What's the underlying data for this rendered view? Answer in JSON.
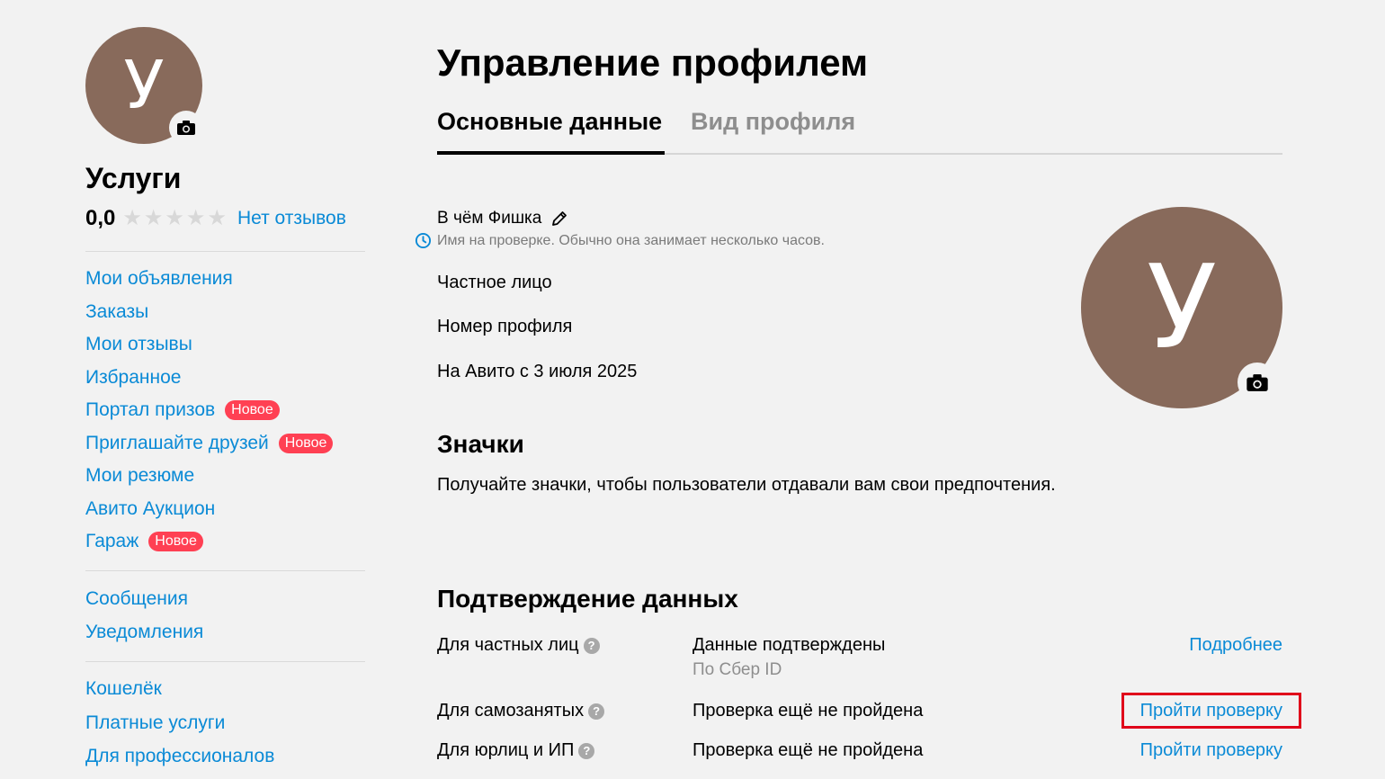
{
  "sidebar": {
    "avatar_letter": "У",
    "name": "Услуги",
    "rating": "0,0",
    "reviews_link": "Нет отзывов",
    "nav_group1": [
      {
        "label": "Мои объявления"
      },
      {
        "label": "Заказы"
      },
      {
        "label": "Мои отзывы"
      },
      {
        "label": "Избранное"
      },
      {
        "label": "Портал призов",
        "badge": "Новое"
      },
      {
        "label": "Приглашайте друзей",
        "badge": "Новое"
      },
      {
        "label": "Мои резюме"
      },
      {
        "label": "Авито Аукцион"
      },
      {
        "label": "Гараж",
        "badge": "Новое"
      }
    ],
    "nav_group2": [
      {
        "label": "Сообщения"
      },
      {
        "label": "Уведомления"
      }
    ],
    "nav_group3": [
      {
        "label": "Кошелёк"
      },
      {
        "label": "Платные услуги"
      },
      {
        "label": "Для профессионалов"
      }
    ]
  },
  "main": {
    "title": "Управление профилем",
    "tabs": [
      {
        "label": "Основные данные",
        "active": true
      },
      {
        "label": "Вид профиля",
        "active": false
      }
    ],
    "profile_name": "В чём Фишка",
    "name_notice": "Имя на проверке. Обычно она занимает несколько часов.",
    "account_type": "Частное лицо",
    "profile_number_label": "Номер профиля",
    "member_since": "На Авито с 3 июля 2025",
    "big_avatar_letter": "У"
  },
  "badges_section": {
    "title": "Значки",
    "description": "Получайте значки, чтобы пользователи отдавали вам свои предпочтения."
  },
  "verification": {
    "title": "Подтверждение данных",
    "rows": [
      {
        "label": "Для частных лиц",
        "status": "Данные подтверждены",
        "substatus": "По Сбер ID",
        "action": "Подробнее"
      },
      {
        "label": "Для самозанятых",
        "status": "Проверка ещё не пройдена",
        "action": "Пройти проверку",
        "highlighted": true
      },
      {
        "label": "Для юрлиц и ИП",
        "status": "Проверка ещё не пройдена",
        "action": "Пройти проверку"
      }
    ]
  },
  "icons": {
    "camera": "camera-icon",
    "pencil": "pencil-icon",
    "clock": "clock-icon",
    "star": "star-icon",
    "question": "question-icon"
  },
  "colors": {
    "link": "#0a8ad6",
    "badge": "#ff4053",
    "avatar": "#886a5b",
    "highlight": "#e0001a"
  }
}
